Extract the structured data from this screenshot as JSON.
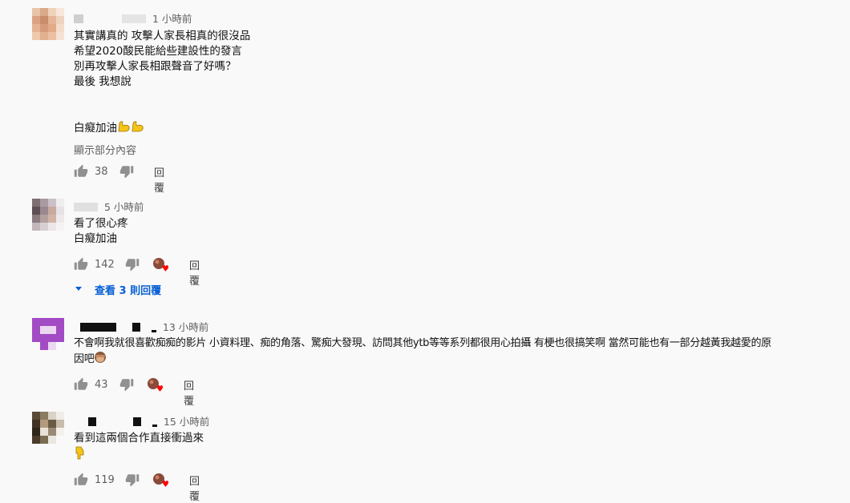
{
  "comments": [
    {
      "time": "1 小時前",
      "lines": [
        "其實講真的 攻擊人家長相真的很沒品",
        "希望2020酸民能給些建設性的發言",
        "別再攻擊人家長相跟聲音了好嗎？",
        "最後 我想說",
        "",
        "",
        "白癡加油"
      ],
      "show_more": "顯示部分內容",
      "likes": "38",
      "reply_label": "回覆"
    },
    {
      "time": "5 小時前",
      "lines": [
        "看了很心疼",
        "白癡加油"
      ],
      "likes": "142",
      "reply_label": "回覆",
      "view_replies": "查看 3 則回覆"
    },
    {
      "time": "13 小時前",
      "lines": [
        "不會啊我就很喜歡痴痴的影片 小資料理、痴的角落、驚痴大發現、訪問其他ytb等等系列都很用心拍攝 有梗也很搞笑啊 當然可能也有一部分越黃我越愛的原",
        "因吧"
      ],
      "likes": "43",
      "reply_label": "回覆"
    },
    {
      "time": "15 小時前",
      "lines": [
        "看到這兩個合作直接衝過來"
      ],
      "likes": "119",
      "reply_label": "回覆"
    }
  ],
  "icons": {
    "like": "thumbs-up-icon",
    "dislike": "thumbs-down-icon",
    "creator_heart": "creator-heart-icon",
    "expand": "caret-down-icon"
  },
  "colors": {
    "link_blue": "#065fd4",
    "heart_red": "#ff0000",
    "muted": "#606060"
  }
}
